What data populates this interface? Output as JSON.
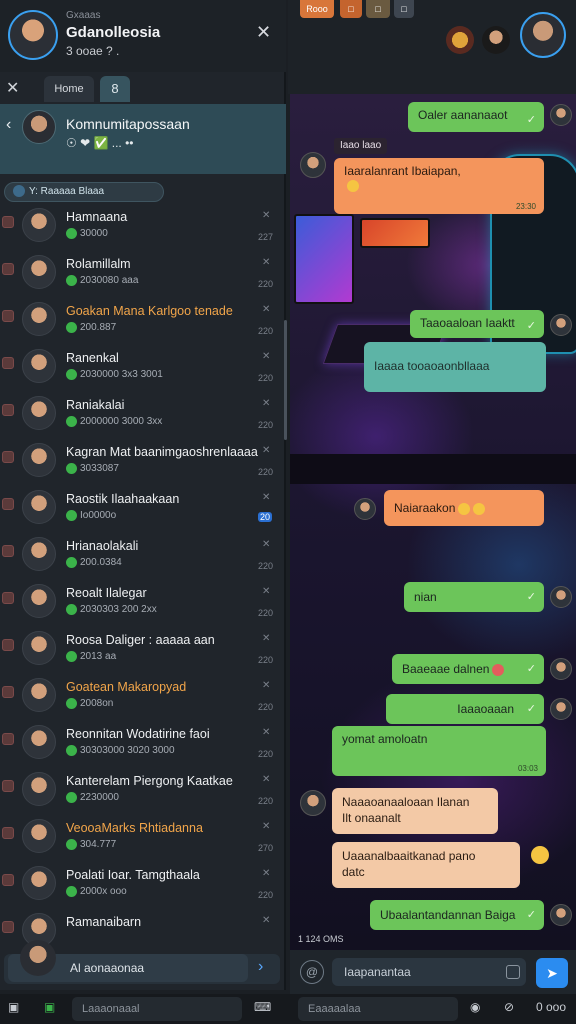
{
  "me": {
    "sub": "Gxaaas",
    "name": "Gdanolleosia",
    "status": "3 ooae ? ."
  },
  "tabs": {
    "home": "Home",
    "user": "8"
  },
  "community": {
    "name": "Komnumitapossaan",
    "sub": "☉ ❤ ✅ ... ••"
  },
  "filter": {
    "label": "Y: Raaaaa Blaaa"
  },
  "chats": [
    {
      "name": "Hamnaana",
      "preview": "30000",
      "time": "227",
      "orange": false
    },
    {
      "name": "Rolamillalm",
      "preview": "2030080 aaa",
      "time": "220",
      "orange": false
    },
    {
      "name": "Goakan Mana Karlgoo tenade",
      "preview": "200.887",
      "time": "220",
      "orange": true
    },
    {
      "name": "Ranenkal",
      "preview": "2030000 3x3 3001",
      "time": "220",
      "orange": false
    },
    {
      "name": "Raniakalai",
      "preview": "2000000 3000 3xx",
      "time": "220",
      "orange": false
    },
    {
      "name": "Kagran Mat baanimgaoshrenlaaaa",
      "preview": "3033087",
      "time": "220",
      "orange": false
    },
    {
      "name": "Raostik Ilaahaakaan",
      "preview": "Io0000o",
      "time": "20",
      "badge": true,
      "orange": false
    },
    {
      "name": "Hrianaolakali",
      "preview": "200.0384",
      "time": "220",
      "orange": false
    },
    {
      "name": "Reoalt Ilalegar",
      "preview": "2030303 200 2xx",
      "time": "220",
      "orange": false
    },
    {
      "name": "Roosa Daliger : aaaaa aan",
      "preview": "2013 aa",
      "time": "220",
      "orange": false
    },
    {
      "name": "Goatean Makaropyad",
      "preview": "2008on",
      "time": "220",
      "orange": true
    },
    {
      "name": "Reonnitan Wodatirine faoi",
      "preview": "30303000 3020 3000",
      "time": "220",
      "orange": false
    },
    {
      "name": "Kanterelam Piergong Kaatkae",
      "preview": "2230000",
      "time": "220",
      "orange": false
    },
    {
      "name": "VeooaMarks Rhtiadanna",
      "preview": "304.777",
      "time": "270",
      "orange": true
    },
    {
      "name": "Poalati Ioar. Tamgthaala",
      "preview": "2000x ooo",
      "time": "220",
      "orange": false
    },
    {
      "name": "Ramanaibarn",
      "preview": "",
      "time": "",
      "orange": false
    }
  ],
  "ai_bar": {
    "placeholder": "Al aonaaonaa"
  },
  "top_pills": [
    "Rooo",
    "□",
    "□",
    "□"
  ],
  "messages": [
    {
      "text": "Oaler aananaaot",
      "style": "green"
    },
    {
      "text": "Iaao laao",
      "style": "label"
    },
    {
      "text": "Iaaralanrant Ibaiapan,",
      "style": "orange",
      "time": "23:30"
    },
    {
      "text": "Taaoaaloan Iaaktt",
      "style": "green"
    },
    {
      "text": "Iaaaa  tooaoaonbllaaa",
      "style": "teal"
    },
    {
      "text": "Naiaraakon",
      "style": "orange"
    },
    {
      "text": "nian",
      "style": "green"
    },
    {
      "text": "Baaeaae dalnen",
      "style": "green"
    },
    {
      "text": "Iaaaoaaan",
      "style": "green"
    },
    {
      "text": "yomat amoloatn",
      "style": "green",
      "time": "03:03"
    },
    {
      "text": "Naaaoanaaloaan Ilanan\nIlt onaanalt",
      "style": "peach"
    },
    {
      "text": "Uaaanalbaaitkanad pano\ndatc",
      "style": "peach"
    },
    {
      "text": "Ubaalantandannan Baiga",
      "style": "green"
    }
  ],
  "chat_date": "1 124 OMS",
  "composer": {
    "placeholder": "Iaapanantaa"
  },
  "bottom": {
    "left_field": "Laaaonaaal",
    "right_field": "Eaaaaalaa",
    "zoom": "0 ooo"
  }
}
